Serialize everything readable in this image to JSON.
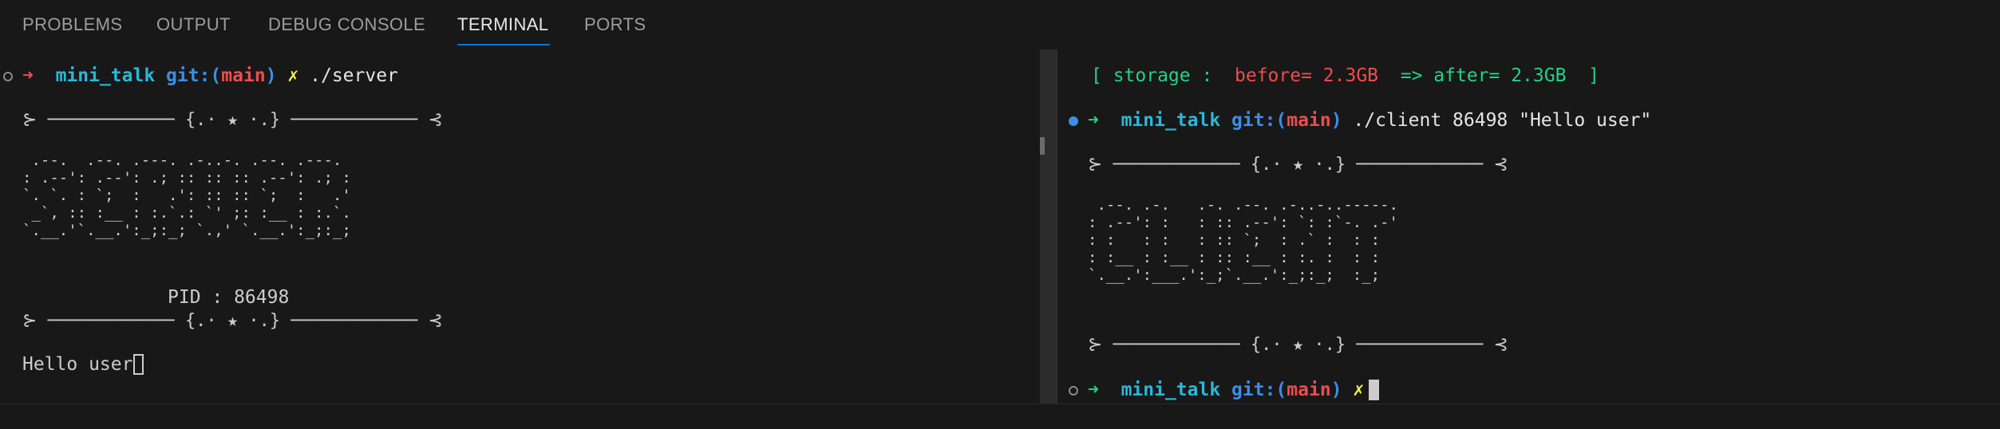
{
  "panel": {
    "tabs": [
      {
        "label": "PROBLEMS",
        "active": false
      },
      {
        "label": "OUTPUT",
        "active": false
      },
      {
        "label": "DEBUG CONSOLE",
        "active": false
      },
      {
        "label": "TERMINAL",
        "active": true
      },
      {
        "label": "PORTS",
        "active": false
      }
    ]
  },
  "icons": {
    "prompt_arrow": "arrow-right-icon",
    "dirty_mark": "x-mark-icon",
    "command_status": "circle-icon"
  },
  "colors": {
    "accent": "#0078d4",
    "arrow_error": "#f14c4c",
    "arrow_ok": "#23d18b",
    "directory": "#29b8db",
    "git_label": "#3b8eea",
    "branch": "#f14c4c",
    "dirty": "#f5f543",
    "storage_before": "#f14c4c",
    "storage_after": "#23d18b"
  },
  "left": {
    "prompt": {
      "arrow": "➜",
      "dir": "mini_talk",
      "git": "git:(",
      "branch": "main",
      "git_close": ")",
      "dirty": "✗",
      "command": "./server"
    },
    "divider_top": "⊱ ──────────── {.⋅ ★ ⋅.} ──────────── ⊰",
    "banner": " .--.  .--. .---. .-..-. .--. .---.\n: .--': .--': .; :: :: :: .--': .; :\n`. `. : `;  :   .': :: :: `;  :   .'\n _`, :: :__ : :.`.: `' ;: :__ : :.`.\n`.__.'`.__.':_;:_; `.,' `.__.':_;:_;",
    "pid_label": "PID : 86498",
    "divider_bottom": "⊱ ──────────── {.⋅ ★ ⋅.} ──────────── ⊰",
    "received": "Hello user"
  },
  "right": {
    "storage": {
      "open": "[ storage :  ",
      "before": "before= 2.3GB",
      "arrow": "  => after= ",
      "after_value": "2.3GB",
      "close": "  ]"
    },
    "prompt1": {
      "arrow": "➜",
      "dir": "mini_talk",
      "git": "git:(",
      "branch": "main",
      "git_close": ")",
      "command": "./client 86498 \"Hello user\""
    },
    "divider_top": "⊱ ──────────── {.⋅ ★ ⋅.} ──────────── ⊰",
    "banner": " .--. .-.   .-. .--. .-..-..-----.\n: .--': :   : :: .--': `: :`-. .-'\n: :   : :   : :: `;  : .` :  : :\n: :__ : :__ : :: :__ : :. :  : :\n`.__.':___.':_;`.__.':_;:_;  :_;",
    "divider_bottom": "⊱ ──────────── {.⋅ ★ ⋅.} ──────────── ⊰",
    "prompt2": {
      "arrow": "➜",
      "dir": "mini_talk",
      "git": "git:(",
      "branch": "main",
      "git_close": ")",
      "dirty": "✗"
    }
  }
}
